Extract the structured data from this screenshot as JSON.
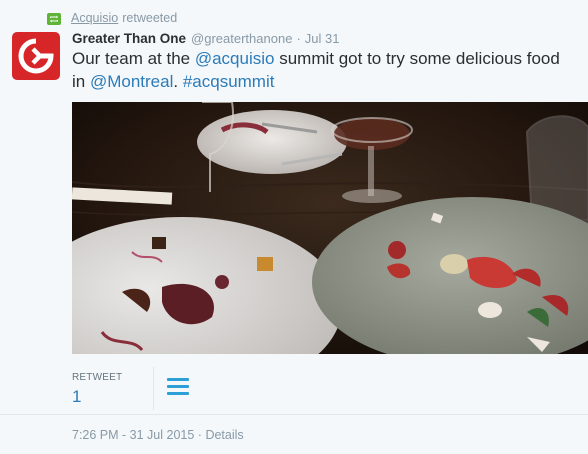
{
  "retweet_context": {
    "user": "Acquisio",
    "suffix": "retweeted",
    "icon": "retweet-icon"
  },
  "tweet": {
    "author": {
      "display_name": "Greater Than One",
      "screen_name": "@greaterthanone",
      "avatar_icon": "greater-than-one-logo"
    },
    "separator": "·",
    "date": "Jul 31",
    "text": {
      "part1": "Our team at the ",
      "mention1": "@acquisio",
      "part2": " summit got to try some delicious food in ",
      "mention2": "@Montreal",
      "part3": ". ",
      "hashtag": "#acqsummit"
    },
    "photo_alt": "photo"
  },
  "stats": {
    "retweet_label": "RETWEET",
    "retweet_count": "1",
    "menu_icon": "hamburger-icon"
  },
  "footer": {
    "timestamp": "7:26 PM - 31 Jul 2015",
    "separator": "·",
    "details": "Details"
  },
  "colors": {
    "link": "#2b7bb9",
    "muted": "#8899a6",
    "brand": "#d72628",
    "retweet_green": "#5fb336"
  }
}
